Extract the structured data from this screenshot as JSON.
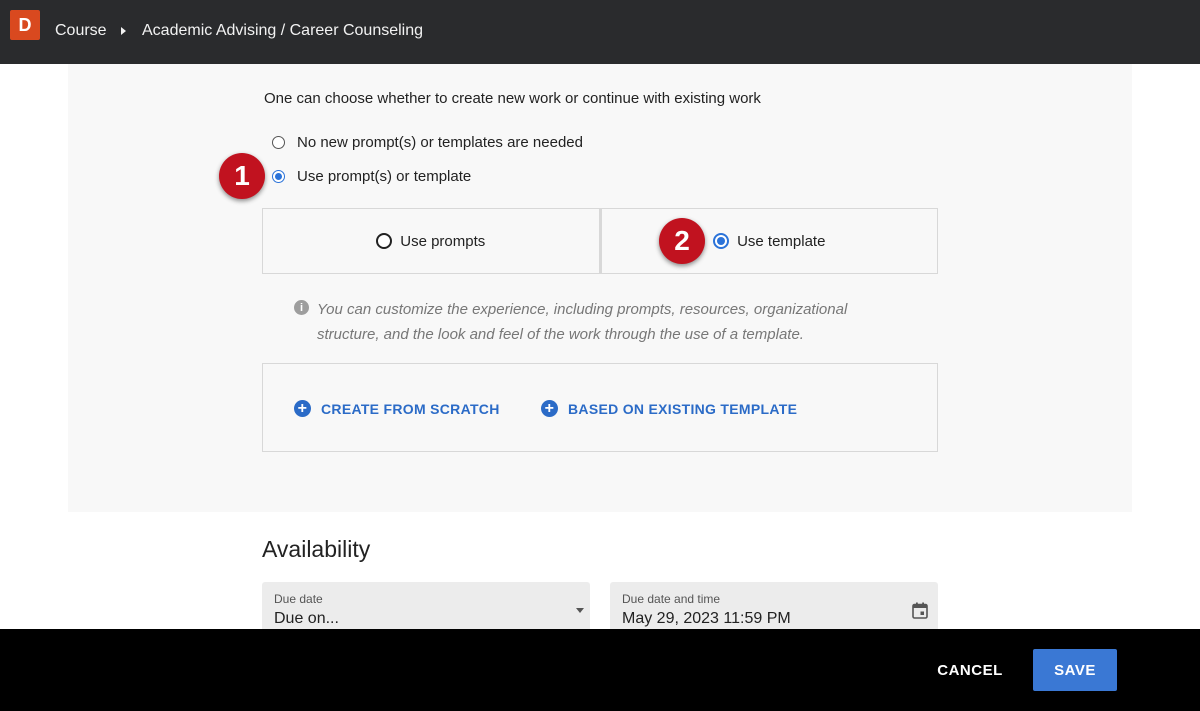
{
  "header": {
    "logo_letter": "D",
    "breadcrumb": [
      "Course",
      "Academic Advising / Career Counseling"
    ]
  },
  "work": {
    "intro": "One can choose whether to create new work or continue with existing work",
    "options": [
      {
        "label": "No new prompt(s) or templates are needed",
        "selected": false
      },
      {
        "label": "Use prompt(s) or template",
        "selected": true
      }
    ],
    "mode_options": [
      {
        "label": "Use prompts",
        "selected": false
      },
      {
        "label": "Use template",
        "selected": true
      }
    ],
    "info_text": "You can customize the experience, including prompts, resources, organizational structure, and the look and feel of the work through the use of a template.",
    "create_from_scratch": "CREATE FROM SCRATCH",
    "based_on_existing": "BASED ON EXISTING TEMPLATE"
  },
  "callouts": [
    "1",
    "2"
  ],
  "availability": {
    "title": "Availability",
    "due_date": {
      "label": "Due date",
      "value": "Due on..."
    },
    "due_date_time": {
      "label": "Due date and time",
      "value": "May 29, 2023 11:59 PM"
    }
  },
  "footer": {
    "cancel": "CANCEL",
    "save": "SAVE"
  },
  "colors": {
    "accent": "#2b73d9",
    "callout": "#c1121f",
    "logo": "#d9491f",
    "topbar": "#2a2b2d"
  },
  "icons": [
    "info-icon",
    "plus-circle-icon",
    "calendar-icon",
    "dropdown-caret-icon",
    "breadcrumb-chevron-icon"
  ]
}
